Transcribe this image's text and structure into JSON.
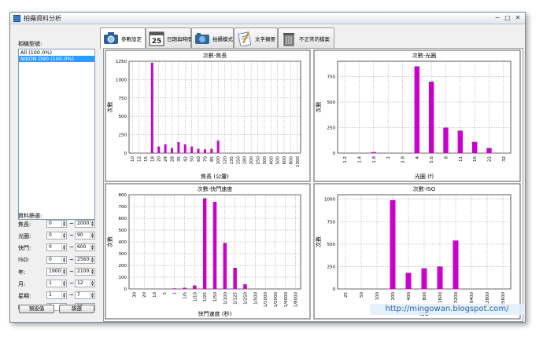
{
  "window": {
    "title": "拍攝資料分析",
    "min": "−",
    "max": "□",
    "close": "✕"
  },
  "left_panel": {
    "camera_label": "相機型號:",
    "camera_items": [
      "All (100.0%)",
      "NIKON D90 (100.0%)"
    ],
    "filter_title": "資料篩選:",
    "filters": [
      {
        "label": "焦長:",
        "from": "0",
        "to": "2000"
      },
      {
        "label": "光圈:",
        "from": "0",
        "to": "90"
      },
      {
        "label": "快門:",
        "from": "0",
        "to": "600"
      },
      {
        "label": "ISO:",
        "from": "0",
        "to": "2560"
      },
      {
        "label": "年:",
        "from": "1900",
        "to": "2100"
      },
      {
        "label": "月:",
        "from": "1",
        "to": "12"
      },
      {
        "label": "星期:",
        "from": "1",
        "to": "7"
      },
      {
        "label": "時:",
        "from": "0",
        "to": "23"
      }
    ],
    "range_sep": "~",
    "reset_button": "預設值",
    "apply_button": "篩選"
  },
  "tabs": [
    {
      "label": "參數設定",
      "icon": "camera-settings-icon",
      "day": ""
    },
    {
      "label": "日期與時間",
      "icon": "calendar-icon",
      "day": "25"
    },
    {
      "label": "拍攝模式",
      "icon": "shooting-mode-icon",
      "day": ""
    },
    {
      "label": "文字摘要",
      "icon": "notepad-icon",
      "day": ""
    },
    {
      "label": "不正常的檔案",
      "icon": "trash-icon",
      "day": ""
    }
  ],
  "watermark": "http://mingowan.blogspot.com/",
  "chart_data": [
    {
      "type": "bar",
      "title": "次數-焦長",
      "xlabel": "焦長 (公釐)",
      "ylabel": "次數",
      "categories": [
        "10",
        "12",
        "15",
        "18",
        "20",
        "24",
        "28",
        "35",
        "42",
        "50",
        "60",
        "70",
        "85",
        "100",
        "120",
        "135",
        "150",
        "180",
        "200",
        "250",
        "300",
        "400",
        "500",
        "600",
        "800",
        "1000"
      ],
      "values": [
        0,
        0,
        0,
        1230,
        90,
        120,
        70,
        150,
        120,
        90,
        60,
        50,
        60,
        170,
        0,
        0,
        0,
        0,
        0,
        0,
        0,
        0,
        0,
        0,
        0,
        0
      ],
      "ylim": [
        0,
        1250
      ],
      "yticks": [
        0,
        250,
        500,
        750,
        1000,
        1250
      ],
      "color": "#cc00cc",
      "grid": true
    },
    {
      "type": "bar",
      "title": "次數-光圈",
      "xlabel": "光圈 (f)",
      "ylabel": "次數",
      "categories": [
        "1.2",
        "1.4",
        "1.8",
        "2",
        "2.8",
        "4",
        "5.6",
        "8",
        "11",
        "16",
        "22",
        "32"
      ],
      "values": [
        0,
        0,
        10,
        0,
        0,
        850,
        700,
        250,
        220,
        110,
        50,
        0
      ],
      "ylim": [
        0,
        900
      ],
      "yticks": [
        0,
        250,
        500,
        750
      ],
      "color": "#cc00cc",
      "grid": true
    },
    {
      "type": "bar",
      "title": "次數-快門速度",
      "xlabel": "快門速度 (秒)",
      "ylabel": "次數",
      "categories": [
        "30",
        "20",
        "10",
        "5",
        "1",
        "1/5",
        "1/10",
        "1/25",
        "1/50",
        "1/100",
        "1/125",
        "1/250",
        "1/500",
        "1/1000",
        "1/2000",
        "1/4000",
        "1/8000"
      ],
      "values": [
        0,
        0,
        0,
        0,
        5,
        10,
        30,
        770,
        740,
        390,
        180,
        40,
        0,
        0,
        0,
        0,
        0
      ],
      "ylim": [
        0,
        800
      ],
      "yticks": [
        0,
        100,
        200,
        300,
        400,
        500,
        600,
        700,
        800
      ],
      "color": "#cc00cc",
      "grid": true
    },
    {
      "type": "bar",
      "title": "次數-ISO",
      "xlabel": "ISO",
      "ylabel": "次數",
      "categories": [
        "25",
        "50",
        "100",
        "200",
        "400",
        "800",
        "1600",
        "3200",
        "6400",
        "12800",
        "25600"
      ],
      "values": [
        0,
        0,
        0,
        990,
        180,
        230,
        250,
        540,
        0,
        0,
        0
      ],
      "ylim": [
        0,
        1050
      ],
      "yticks": [
        0,
        250,
        500,
        750,
        1000
      ],
      "color": "#cc00cc",
      "grid": true
    }
  ]
}
